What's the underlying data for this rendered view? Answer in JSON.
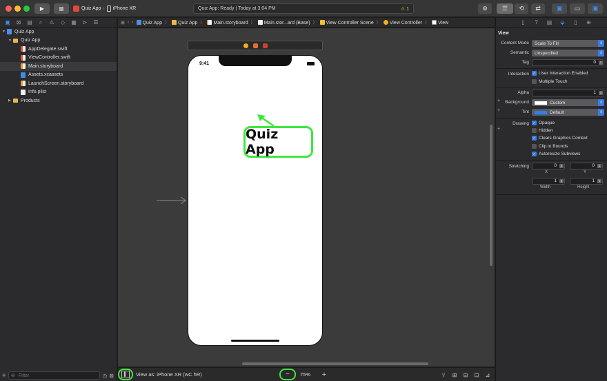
{
  "titlebar": {
    "scheme_app": "Quiz App",
    "scheme_device": "iPhone XR",
    "status": "Quiz App: Ready | Today at 3:04 PM",
    "warning_count": "1"
  },
  "navigator": {
    "items": [
      {
        "label": "Quiz App",
        "type": "project"
      },
      {
        "label": "Quiz App",
        "type": "folder"
      },
      {
        "label": "AppDelegate.swift",
        "type": "swift"
      },
      {
        "label": "ViewController.swift",
        "type": "swift"
      },
      {
        "label": "Main.storyboard",
        "type": "storyboard"
      },
      {
        "label": "Assets.xcassets",
        "type": "assets"
      },
      {
        "label": "LaunchScreen.storyboard",
        "type": "storyboard"
      },
      {
        "label": "Info.plist",
        "type": "plist"
      },
      {
        "label": "Products",
        "type": "folder"
      }
    ],
    "filter_placeholder": "Filter"
  },
  "jumpbar": {
    "crumbs": [
      "Quiz App",
      "Quiz App",
      "Main.storyboard",
      "Main.stor...ard (Base)",
      "View Controller Scene",
      "View Controller",
      "View"
    ]
  },
  "canvas": {
    "phone_time": "9:41",
    "label_text": "Quiz App"
  },
  "bottombar": {
    "view_as": "View as: iPhone XR (wC hR)",
    "zoom": "75%"
  },
  "inspector": {
    "section": "View",
    "content_mode_label": "Content Mode",
    "content_mode": "Scale To Fill",
    "semantic_label": "Semantic",
    "semantic": "Unspecified",
    "tag_label": "Tag",
    "tag": "0",
    "interaction_label": "Interaction",
    "user_interaction": "User Interaction Enabled",
    "multiple_touch": "Multiple Touch",
    "alpha_label": "Alpha",
    "alpha": "1",
    "background_label": "Background",
    "background": "Custom",
    "tint_label": "Tint",
    "tint": "Default",
    "drawing_label": "Drawing",
    "opaque": "Opaque",
    "hidden": "Hidden",
    "clears_graphics": "Clears Graphics Context",
    "clip_bounds": "Clip to Bounds",
    "autoresize": "Autoresize Subviews",
    "stretching_label": "Stretching",
    "stretch_x": "0",
    "stretch_y": "0",
    "stretch_w": "1",
    "stretch_h": "1",
    "x_label": "X",
    "y_label": "Y",
    "width_label": "Width",
    "height_label": "Height"
  },
  "colors": {
    "accent": "#3a7be0",
    "highlight": "#3fe73f",
    "tint_default": "#2f7ff0"
  }
}
